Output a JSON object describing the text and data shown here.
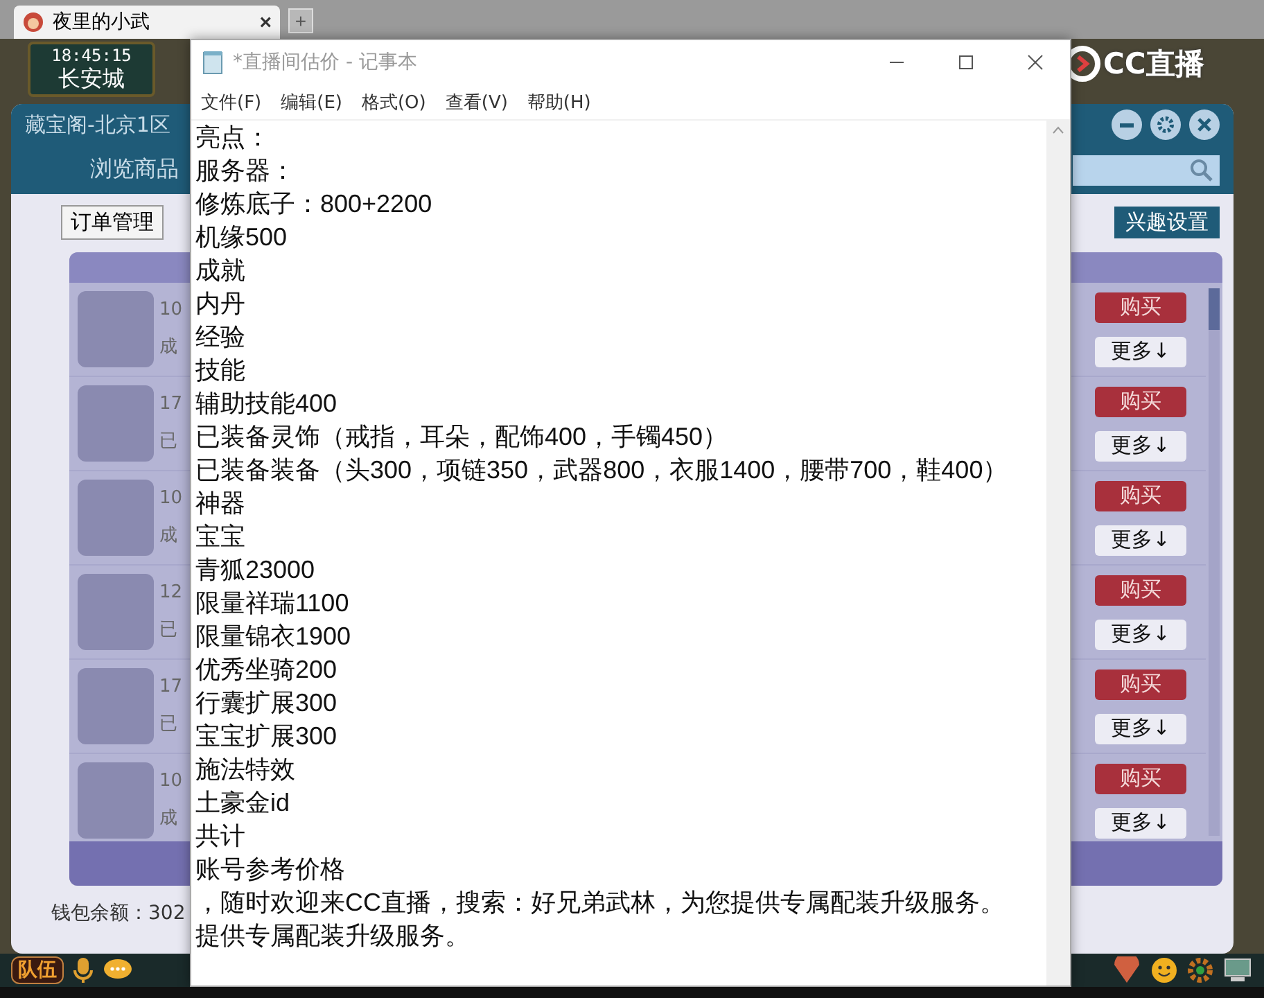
{
  "browser": {
    "tab": {
      "title": "夜里的小武",
      "close": "×"
    },
    "new_tab": "+"
  },
  "hud": {
    "time": "18:45:15",
    "location": "长安城"
  },
  "logo": {
    "text": "CC直播"
  },
  "shop": {
    "title": "藏宝阁-北京1区",
    "tab": "浏览商品",
    "order_button": "订单管理",
    "interest_button": "兴趣设置",
    "rows": [
      {
        "line_1": "10",
        "line_2": "成",
        "buy": "购买",
        "more": "更多↓"
      },
      {
        "line_1": "17",
        "line_2": "已",
        "buy": "购买",
        "more": "更多↓"
      },
      {
        "line_1": "10",
        "line_2": "成",
        "buy": "购买",
        "more": "更多↓"
      },
      {
        "line_1": "12",
        "line_2": "已",
        "buy": "购买",
        "more": "更多↓"
      },
      {
        "line_1": "17",
        "line_2": "已",
        "buy": "购买",
        "more": "更多↓"
      },
      {
        "line_1": "10",
        "line_2": "成",
        "buy": "购买",
        "more": "更多↓"
      }
    ],
    "wallet": "钱包余额：302"
  },
  "notepad": {
    "title": "*直播间估价 - 记事本",
    "menu": [
      "文件(F)",
      "编辑(E)",
      "格式(O)",
      "查看(V)",
      "帮助(H)"
    ],
    "lines": [
      "亮点：",
      "服务器：",
      "修炼底子：800+2200",
      "机缘500",
      "成就",
      "内丹",
      "经验",
      "技能",
      "辅助技能400",
      "已装备灵饰（戒指，耳朵，配饰400，手镯450）",
      "已装备装备（头300，项链350，武器800，衣服1400，腰带700，鞋400）",
      "神器",
      "宝宝",
      "青狐23000",
      "限量祥瑞1100",
      "限量锦衣1900",
      "优秀坐骑200",
      "行囊扩展300",
      "宝宝扩展300",
      "施法特效",
      "土豪金id",
      "共计",
      "账号参考价格",
      "，随时欢迎来CC直播，搜索：好兄弟武林，为您提供专属配装升级服务。",
      "提供专属配装升级服务。"
    ]
  },
  "bottom_bar": {
    "team_button": "队伍"
  }
}
